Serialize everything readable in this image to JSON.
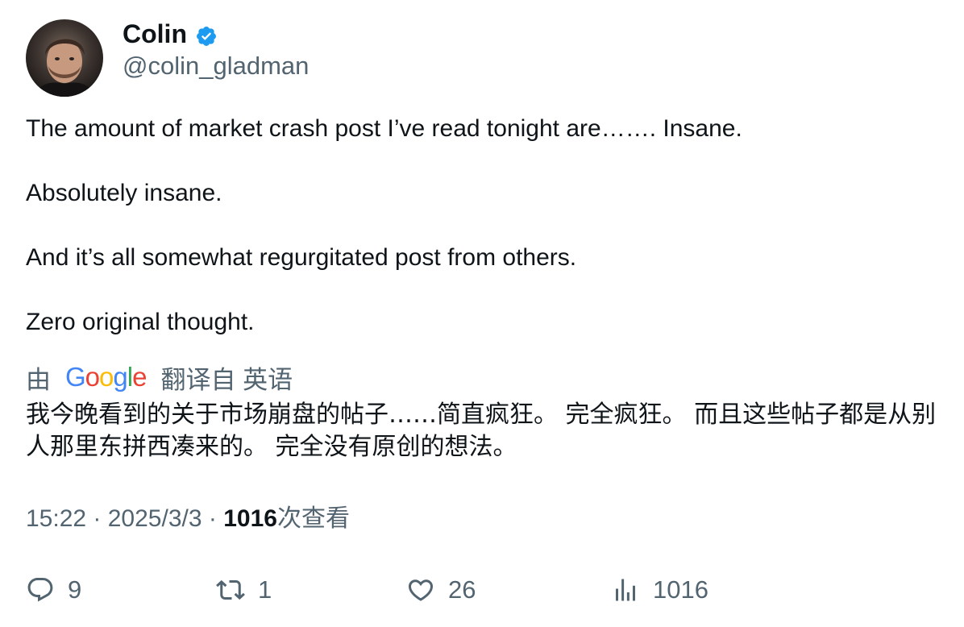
{
  "author": {
    "display_name": "Colin",
    "handle": "@colin_gladman",
    "verified": true,
    "verified_color": "#1d9bf0"
  },
  "tweet": {
    "paragraphs": [
      "The amount of market crash post I’ve read tonight are……. Insane.",
      "Absolutely insane.",
      "And it’s all somewhat regurgitated post from others.",
      "Zero original thought."
    ]
  },
  "translation_bar": {
    "prefix": "由",
    "provider": "Google",
    "suffix": "翻译自 英语"
  },
  "translated_text": "我今晚看到的关于市场崩盘的帖子……简直疯狂。 完全疯狂。 而且这些帖子都是从别人那里东拼西凑来的。 完全没有原创的想法。",
  "meta": {
    "time": "15:22",
    "separator": "·",
    "date": "2025/3/3",
    "views_count": "1016",
    "views_label": "次查看"
  },
  "actions": {
    "reply": {
      "icon": "reply-icon",
      "count": "9"
    },
    "retweet": {
      "icon": "retweet-icon",
      "count": "1"
    },
    "like": {
      "icon": "heart-icon",
      "count": "26"
    },
    "views": {
      "icon": "analytics-icon",
      "count": "1016"
    }
  },
  "colors": {
    "text_primary": "#0f1419",
    "text_secondary": "#536471",
    "google_blue": "#4285f4",
    "google_red": "#ea4335",
    "google_yellow": "#fbbc05",
    "google_green": "#34a853"
  }
}
